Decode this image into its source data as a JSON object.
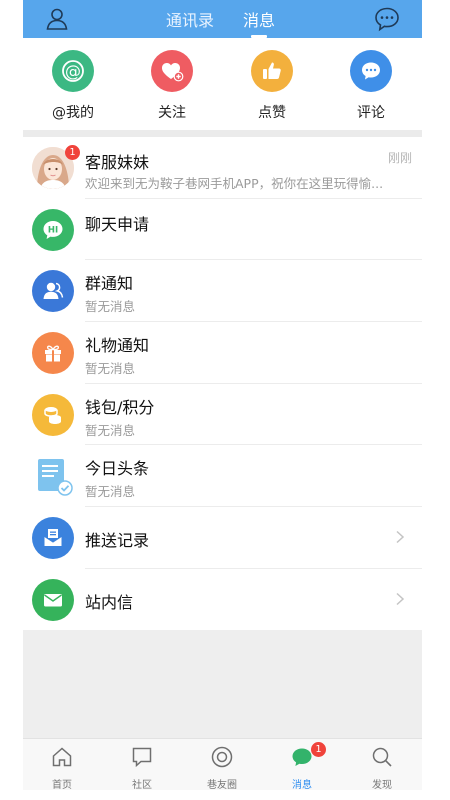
{
  "header": {
    "tabs": [
      {
        "label": "通讯录"
      },
      {
        "label": "消息"
      }
    ],
    "active_tab": "消息",
    "bar_color": "#57a6ec",
    "left_icon": "user-icon",
    "right_icon": "chat-bubble-icon"
  },
  "quick": {
    "items": [
      {
        "label": "@我的",
        "icon": "at-icon",
        "color": "#3cb883"
      },
      {
        "label": "关注",
        "icon": "heart-plus-icon",
        "color": "#ef5c62"
      },
      {
        "label": "点赞",
        "icon": "thumbs-up-icon",
        "color": "#f3b03d"
      },
      {
        "label": "评论",
        "icon": "comment-icon",
        "color": "#3f8fe8"
      }
    ]
  },
  "list": {
    "items": [
      {
        "title": "客服妹妹",
        "subtitle": "欢迎来到无为鞍子巷网手机APP，祝你在这里玩得愉...",
        "time": "刚刚",
        "badge": "1",
        "icon": "avatar"
      },
      {
        "title": "聊天申请",
        "subtitle": "",
        "icon": "hi-chat-icon",
        "color": "#37b768"
      },
      {
        "title": "群通知",
        "subtitle": "暂无消息",
        "icon": "group-icon",
        "color": "#3a78d8"
      },
      {
        "title": "礼物通知",
        "subtitle": "暂无消息",
        "icon": "gift-icon",
        "color": "#f5874b"
      },
      {
        "title": "钱包/积分",
        "subtitle": "暂无消息",
        "icon": "coins-icon",
        "color": "#f5b93a"
      },
      {
        "title": "今日头条",
        "subtitle": "暂无消息",
        "icon": "document-check-icon",
        "color": "#7ec3ee"
      },
      {
        "title": "推送记录",
        "subtitle": "",
        "icon": "envelope-tray-icon",
        "color": "#3b82dd"
      },
      {
        "title": "站内信",
        "subtitle": "",
        "icon": "mail-icon",
        "color": "#35b35b"
      }
    ]
  },
  "bottom_nav": {
    "items": [
      {
        "label": "首页",
        "icon": "home-icon"
      },
      {
        "label": "社区",
        "icon": "chat-square-icon"
      },
      {
        "label": "巷友圈",
        "icon": "compass-icon"
      },
      {
        "label": "消息",
        "icon": "message-icon",
        "badge": "1"
      },
      {
        "label": "发现",
        "icon": "search-icon"
      }
    ],
    "active": "消息",
    "accent": "#2f8ef0"
  }
}
